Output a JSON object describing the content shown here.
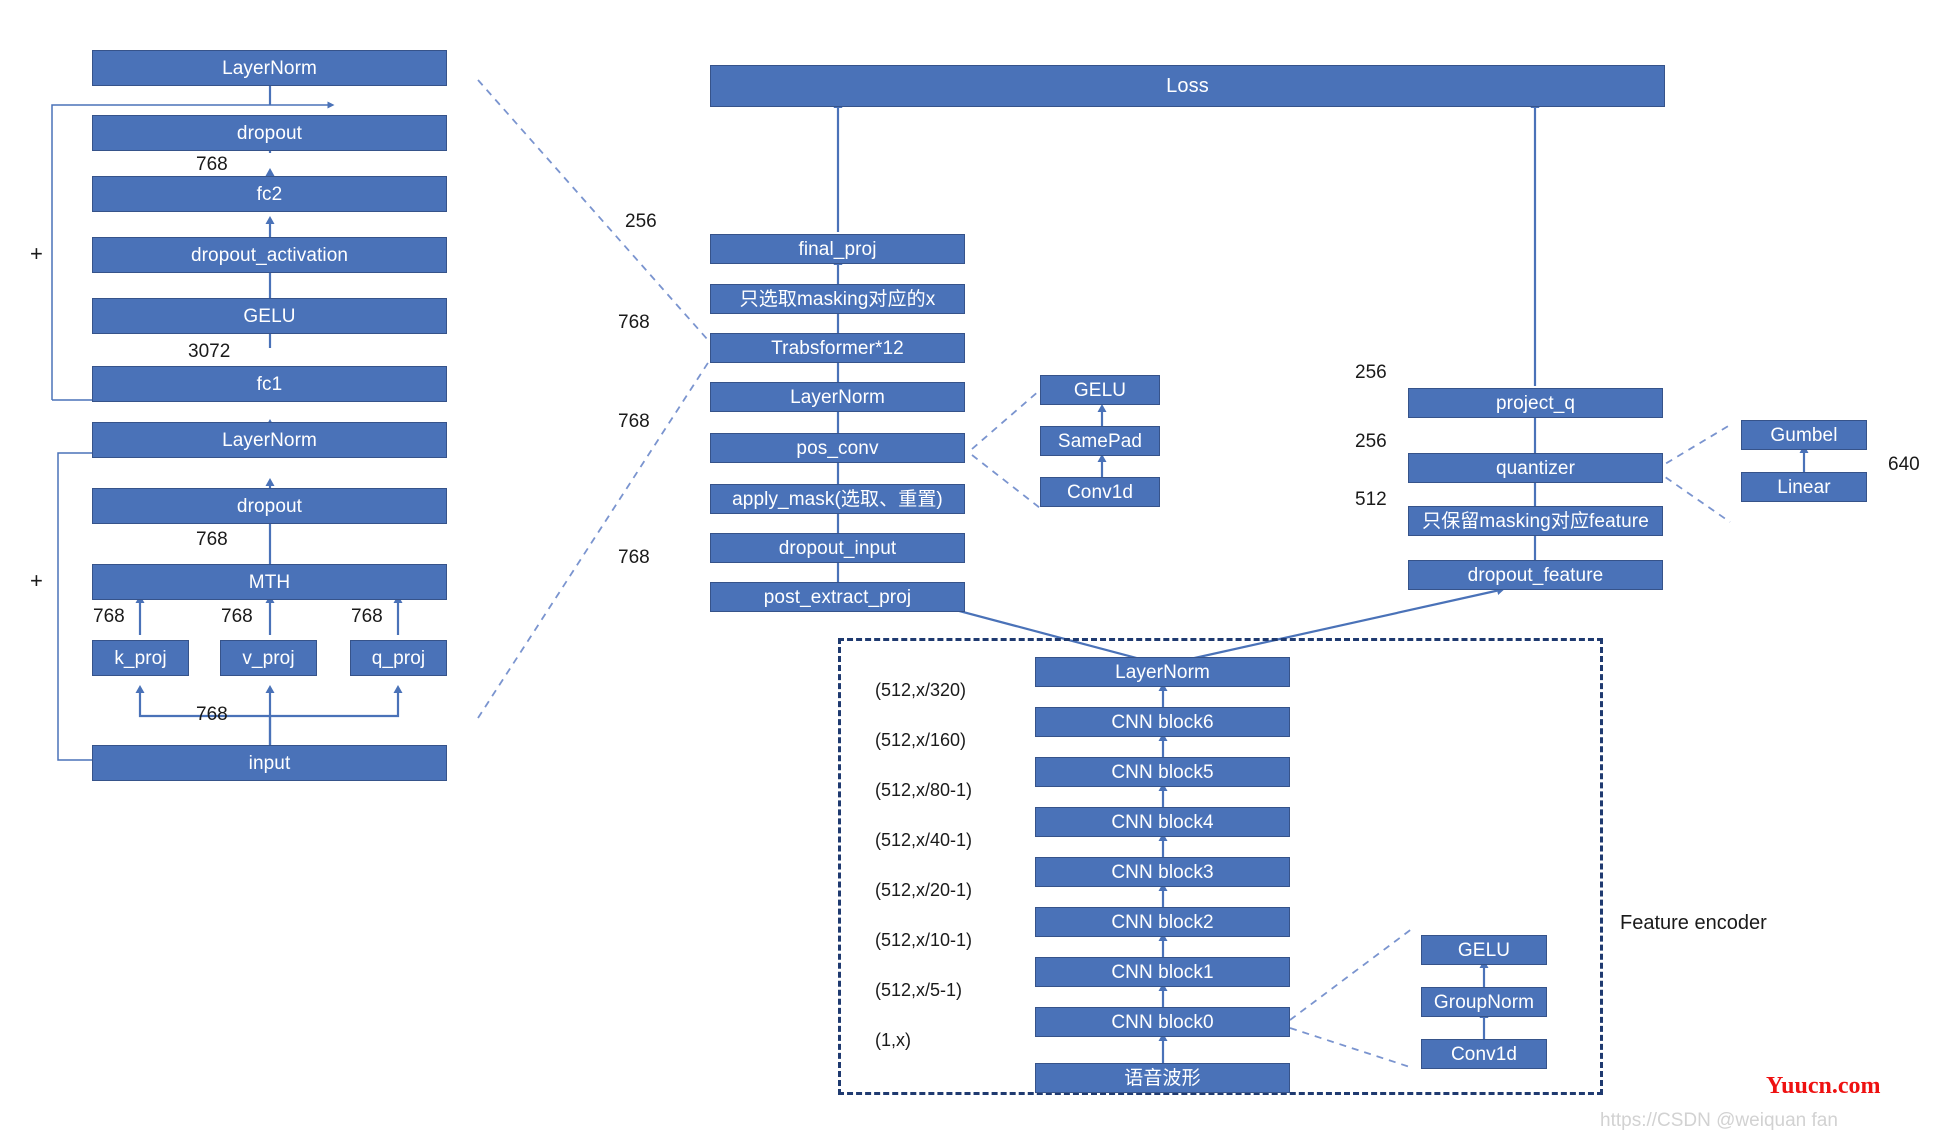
{
  "diagram": {
    "title": "wav2vec 2.0 model architecture diagram",
    "colors": {
      "box_fill": "#4a72b8",
      "box_stroke": "#36538a",
      "arrow": "#4a72b8",
      "dashed_blue": "#5577bb",
      "encoder_border": "#1f3a70",
      "watermark_red": "#ee1111"
    }
  },
  "transformer_block": {
    "boxes": [
      {
        "id": "ln_top",
        "label": "LayerNorm"
      },
      {
        "id": "dropout_top",
        "label": "dropout"
      },
      {
        "id": "fc2",
        "label": "fc2"
      },
      {
        "id": "dropout_activation",
        "label": "dropout_activation"
      },
      {
        "id": "gelu",
        "label": "GELU"
      },
      {
        "id": "fc1",
        "label": "fc1"
      },
      {
        "id": "ln_mid",
        "label": "LayerNorm"
      },
      {
        "id": "dropout_mid",
        "label": "dropout"
      },
      {
        "id": "mth",
        "label": "MTH"
      },
      {
        "id": "k_proj",
        "label": "k_proj"
      },
      {
        "id": "v_proj",
        "label": "v_proj"
      },
      {
        "id": "q_proj",
        "label": "q_proj"
      },
      {
        "id": "input",
        "label": "input"
      }
    ],
    "edge_labels": {
      "dropout_top_in": "768",
      "gelu_in": "3072",
      "dropout_mid_in": "768",
      "k_proj_out": "768",
      "v_proj_out": "768",
      "q_proj_out": "768",
      "input_out": "768"
    },
    "residual_plus_upper": "+",
    "residual_plus_lower": "+"
  },
  "main_column": {
    "boxes": [
      {
        "id": "loss",
        "label": "Loss"
      },
      {
        "id": "final_proj",
        "label": "final_proj"
      },
      {
        "id": "select_mask_x",
        "label": "只选取masking对应的x"
      },
      {
        "id": "transformer12",
        "label": "Trabsformer*12"
      },
      {
        "id": "layernorm",
        "label": "LayerNorm"
      },
      {
        "id": "pos_conv",
        "label": "pos_conv"
      },
      {
        "id": "apply_mask",
        "label": "apply_mask(选取、重置)"
      },
      {
        "id": "dropout_input",
        "label": "dropout_input"
      },
      {
        "id": "post_extract_proj",
        "label": "post_extract_proj"
      }
    ],
    "dim_labels": {
      "final_proj_out": "256",
      "transformer_in": "768",
      "pos_conv_in": "768",
      "post_extract_out": "768"
    }
  },
  "pos_conv_detail": {
    "boxes": [
      {
        "id": "pc_gelu",
        "label": "GELU"
      },
      {
        "id": "pc_samepad",
        "label": "SamePad"
      },
      {
        "id": "pc_conv1d",
        "label": "Conv1d"
      }
    ]
  },
  "quantize_column": {
    "boxes": [
      {
        "id": "project_q",
        "label": "project_q"
      },
      {
        "id": "quantizer",
        "label": "quantizer"
      },
      {
        "id": "keep_mask_feat",
        "label": "只保留masking对应feature"
      },
      {
        "id": "dropout_feature",
        "label": "dropout_feature"
      }
    ],
    "dim_labels": {
      "project_q_out": "256",
      "quantizer_out": "256",
      "keep_mask_out": "512"
    }
  },
  "gumbel_detail": {
    "boxes": [
      {
        "id": "gumbel",
        "label": "Gumbel"
      },
      {
        "id": "linear",
        "label": "Linear"
      }
    ],
    "dim_label": "640"
  },
  "feature_encoder": {
    "title": "Feature encoder",
    "boxes": [
      {
        "id": "fe_layernorm",
        "label": "LayerNorm"
      },
      {
        "id": "cnn_block6",
        "label": "CNN block6"
      },
      {
        "id": "cnn_block5",
        "label": "CNN block5"
      },
      {
        "id": "cnn_block4",
        "label": "CNN block4"
      },
      {
        "id": "cnn_block3",
        "label": "CNN block3"
      },
      {
        "id": "cnn_block2",
        "label": "CNN block2"
      },
      {
        "id": "cnn_block1",
        "label": "CNN block1"
      },
      {
        "id": "cnn_block0",
        "label": "CNN block0"
      },
      {
        "id": "waveform",
        "label": "语音波形"
      }
    ],
    "shape_labels": [
      "(512,x/320)",
      "(512,x/160)",
      "(512,x/80-1)",
      "(512,x/40-1)",
      "(512,x/20-1)",
      "(512,x/10-1)",
      "(512,x/5-1)",
      "(1,x)"
    ],
    "cnn_detail": [
      {
        "id": "cb_gelu",
        "label": "GELU"
      },
      {
        "id": "cb_groupnorm",
        "label": "GroupNorm"
      },
      {
        "id": "cb_conv1d",
        "label": "Conv1d"
      }
    ]
  },
  "watermarks": {
    "red": "Yuucn.com",
    "gray": "https://CSDN @weiquan fan"
  }
}
